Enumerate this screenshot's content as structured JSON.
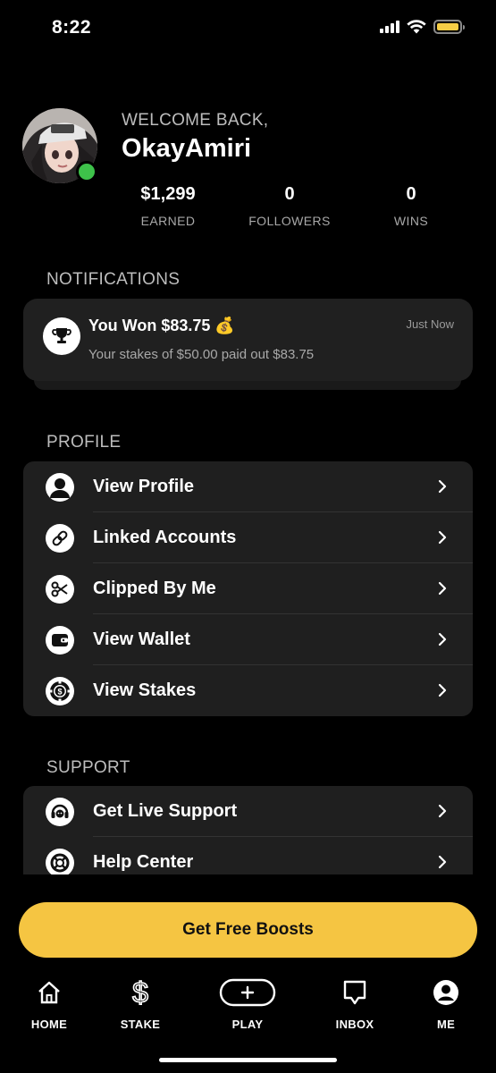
{
  "status_bar": {
    "time": "8:22",
    "signal_icon": "cellular-signal-icon",
    "wifi_icon": "wifi-icon",
    "battery_icon": "battery-icon",
    "battery_color": "#f5cd45"
  },
  "profile": {
    "welcome": "WELCOME BACK,",
    "username": "OkayAmiri",
    "online_color": "#3ec24a",
    "stats": [
      {
        "value": "$1,299",
        "label": "EARNED"
      },
      {
        "value": "0",
        "label": "FOLLOWERS"
      },
      {
        "value": "0",
        "label": "WINS"
      }
    ]
  },
  "notifications": {
    "title": "NOTIFICATIONS",
    "items": [
      {
        "title": "You Won $83.75",
        "emoji": "💰",
        "subtitle": "Your stakes of $50.00 paid out $83.75",
        "time": "Just Now",
        "icon": "trophy-icon"
      }
    ]
  },
  "profile_section": {
    "title": "PROFILE",
    "items": [
      {
        "label": "View Profile",
        "icon": "person-icon"
      },
      {
        "label": "Linked Accounts",
        "icon": "link-icon"
      },
      {
        "label": "Clipped By Me",
        "icon": "scissors-icon"
      },
      {
        "label": "View Wallet",
        "icon": "wallet-icon"
      },
      {
        "label": "View Stakes",
        "icon": "chip-icon"
      }
    ]
  },
  "support_section": {
    "title": "SUPPORT",
    "items": [
      {
        "label": "Get Live Support",
        "icon": "headset-icon"
      },
      {
        "label": "Help Center",
        "icon": "lifebuoy-icon"
      }
    ]
  },
  "cta": {
    "label": "Get Free Boosts",
    "color": "#f5c542"
  },
  "tabbar": {
    "tabs": [
      {
        "label": "HOME",
        "icon": "home-icon"
      },
      {
        "label": "STAKE",
        "icon": "dollar-icon"
      },
      {
        "label": "PLAY",
        "icon": "plus-pill-icon"
      },
      {
        "label": "INBOX",
        "icon": "chat-bubble-icon"
      },
      {
        "label": "ME",
        "icon": "profile-icon"
      }
    ]
  }
}
